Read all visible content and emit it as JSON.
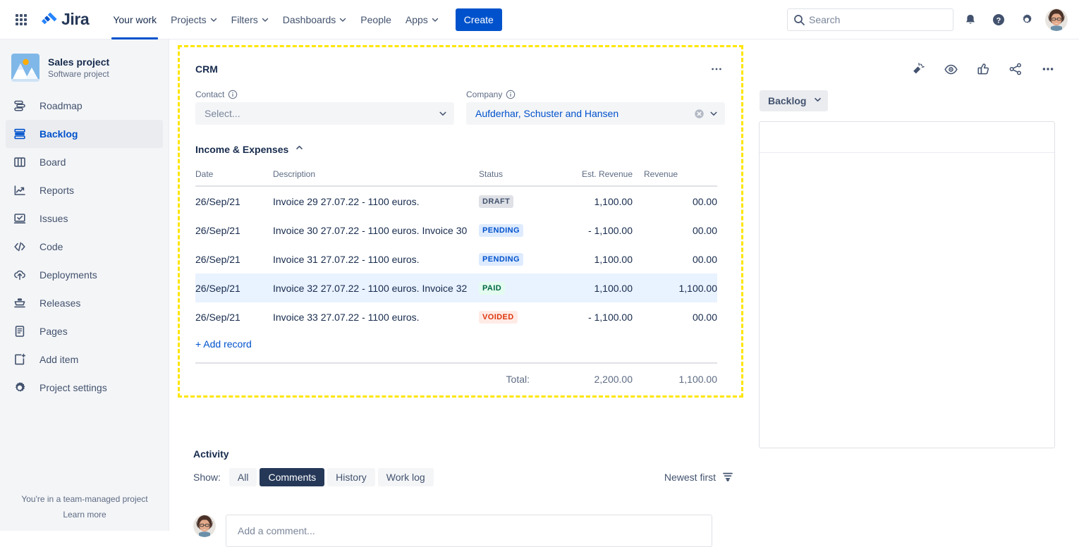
{
  "topnav": {
    "app_switcher": "app-switcher",
    "logo_text": "Jira",
    "items": [
      {
        "label": "Your work",
        "has_caret": false,
        "active": true
      },
      {
        "label": "Projects",
        "has_caret": true,
        "active": false
      },
      {
        "label": "Filters",
        "has_caret": true,
        "active": false
      },
      {
        "label": "Dashboards",
        "has_caret": true,
        "active": false
      },
      {
        "label": "People",
        "has_caret": false,
        "active": false
      },
      {
        "label": "Apps",
        "has_caret": true,
        "active": false
      }
    ],
    "create_label": "Create",
    "search_placeholder": "Search",
    "search_value": "",
    "icons": [
      "notifications-icon",
      "help-icon",
      "settings-icon",
      "profile-avatar"
    ]
  },
  "sidebar": {
    "project_name": "Sales project",
    "project_type": "Software project",
    "items": [
      {
        "label": "Roadmap",
        "icon": "roadmap-icon",
        "active": false
      },
      {
        "label": "Backlog",
        "icon": "backlog-icon",
        "active": true
      },
      {
        "label": "Board",
        "icon": "board-icon",
        "active": false
      },
      {
        "label": "Reports",
        "icon": "reports-icon",
        "active": false
      },
      {
        "label": "Issues",
        "icon": "issues-icon",
        "active": false
      },
      {
        "label": "Code",
        "icon": "code-icon",
        "active": false
      },
      {
        "label": "Deployments",
        "icon": "deployments-icon",
        "active": false
      },
      {
        "label": "Releases",
        "icon": "releases-icon",
        "active": false
      },
      {
        "label": "Pages",
        "icon": "pages-icon",
        "active": false
      },
      {
        "label": "Add item",
        "icon": "add-item-icon",
        "active": false
      },
      {
        "label": "Project settings",
        "icon": "project-settings-icon",
        "active": false
      }
    ],
    "footer_note": "You're in a team-managed project",
    "footer_link": "Learn more"
  },
  "crm": {
    "title": "CRM",
    "more_menu": "•••",
    "contact": {
      "label": "Contact",
      "value": "",
      "placeholder": "Select..."
    },
    "company": {
      "label": "Company",
      "value": "Aufderhar, Schuster and Hansen",
      "placeholder": "Select..."
    },
    "section": {
      "title": "Income & Expenses",
      "expanded": true
    },
    "table": {
      "columns": [
        "Date",
        "Description",
        "Status",
        "Est. Revenue",
        "Revenue"
      ],
      "rows": [
        {
          "date": "26/Sep/21",
          "description": "Invoice 29 27.07.22 - 1100 euros.",
          "status": "DRAFT",
          "status_kind": "draft",
          "est_revenue": "1,100.00",
          "revenue": "00.00",
          "highlight": false
        },
        {
          "date": "26/Sep/21",
          "description": "Invoice 30 27.07.22 - 1100 euros. Invoice 30",
          "status": "PENDING",
          "status_kind": "pending",
          "est_revenue": "- 1,100.00",
          "revenue": "00.00",
          "highlight": false
        },
        {
          "date": "26/Sep/21",
          "description": "Invoice 31 27.07.22 - 1100 euros.",
          "status": "PENDING",
          "status_kind": "pending",
          "est_revenue": "1,100.00",
          "revenue": "00.00",
          "highlight": false
        },
        {
          "date": "26/Sep/21",
          "description": "Invoice 32 27.07.22 - 1100 euros. Invoice 32",
          "status": "PAID",
          "status_kind": "paid",
          "est_revenue": "1,100.00",
          "revenue": "1,100.00",
          "highlight": true
        },
        {
          "date": "26/Sep/21",
          "description": "Invoice 33 27.07.22 - 1100 euros.",
          "status": "VOIDED",
          "status_kind": "voided",
          "est_revenue": "- 1,100.00",
          "revenue": "00.00",
          "highlight": false
        }
      ],
      "add_record_label": "+ Add record",
      "total_label": "Total:",
      "total_est_revenue": "2,200.00",
      "total_revenue": "1,100.00"
    }
  },
  "activity": {
    "title": "Activity",
    "show_label": "Show:",
    "tabs": [
      {
        "label": "All",
        "active": false
      },
      {
        "label": "Comments",
        "active": true
      },
      {
        "label": "History",
        "active": false
      },
      {
        "label": "Work log",
        "active": false
      }
    ],
    "sort_label": "Newest first",
    "comment_placeholder": "Add a comment..."
  },
  "right_panel": {
    "status_label": "Backlog",
    "page_actions": [
      "feedback-icon",
      "watch-icon",
      "like-icon",
      "share-icon",
      "more-actions-icon"
    ]
  },
  "colors": {
    "brand_blue": "#0052cc",
    "highlight_yellow": "#ffe600",
    "row_highlight": "#e9f2ff",
    "text_primary": "#172b4d",
    "text_subtle": "#5e6c84"
  }
}
